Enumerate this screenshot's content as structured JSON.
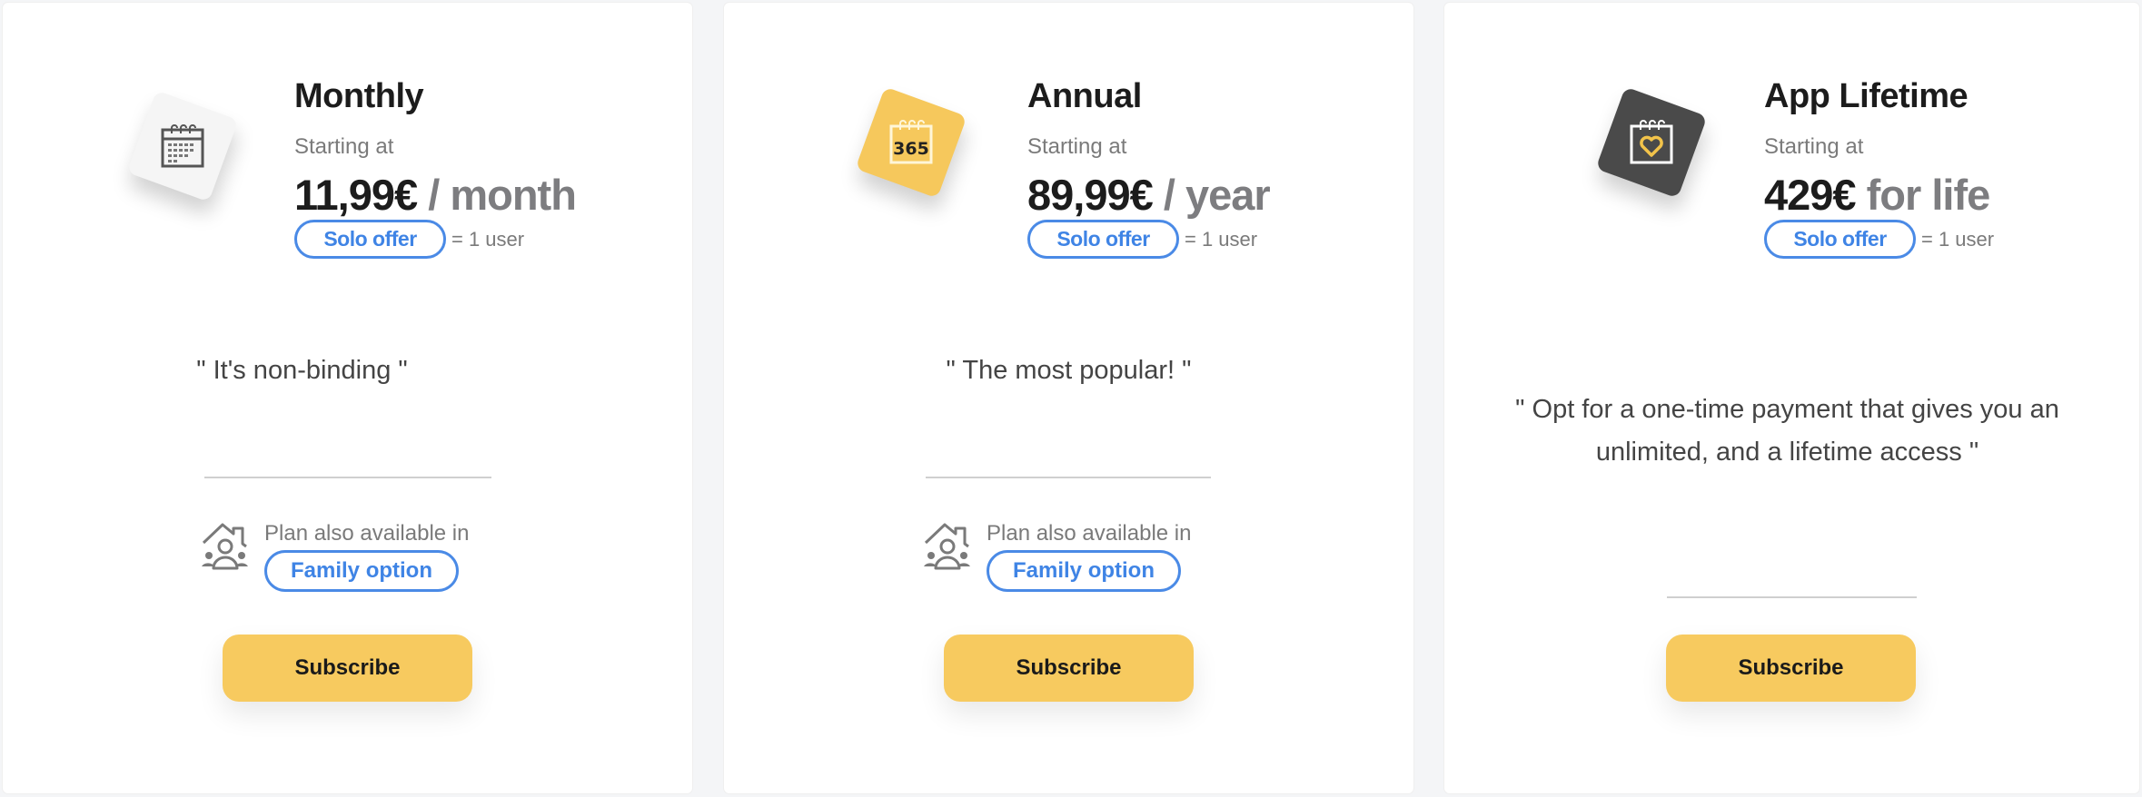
{
  "colors": {
    "page_background": "#f4f5f7",
    "card_background": "#ffffff",
    "accent_blue": "#4a8ae6",
    "subscribe_yellow": "#f7ca5f",
    "annual_icon_bg": "#f6c85c",
    "lifetime_icon_bg": "#4a4a4a",
    "monthly_icon_bg": "#f5f5f5"
  },
  "plans": [
    {
      "icon": "calendar-icon",
      "title": "Monthly",
      "starting_label": "Starting at",
      "price": "11,99€",
      "period": " / month",
      "offer_label": "Solo offer",
      "offer_users": "= 1 user",
      "quote": "\" It's non-binding \"",
      "family_label": "Plan also available in",
      "family_button": "Family option",
      "subscribe_label": "Subscribe"
    },
    {
      "icon": "calendar-365-icon",
      "icon_text": "365",
      "title": "Annual",
      "starting_label": "Starting at",
      "price": "89,99€",
      "period": " / year",
      "offer_label": "Solo offer",
      "offer_users": "= 1 user",
      "quote": "\" The most popular! \"",
      "family_label": "Plan also available in",
      "family_button": "Family option",
      "subscribe_label": "Subscribe"
    },
    {
      "icon": "calendar-heart-icon",
      "title": "App Lifetime",
      "starting_label": "Starting at",
      "price": "429€",
      "period": " for life",
      "offer_label": "Solo offer",
      "offer_users": "= 1 user",
      "quote": "\" Opt for a one-time payment that gives you an unlimited, and a lifetime access \"",
      "subscribe_label": "Subscribe"
    }
  ]
}
